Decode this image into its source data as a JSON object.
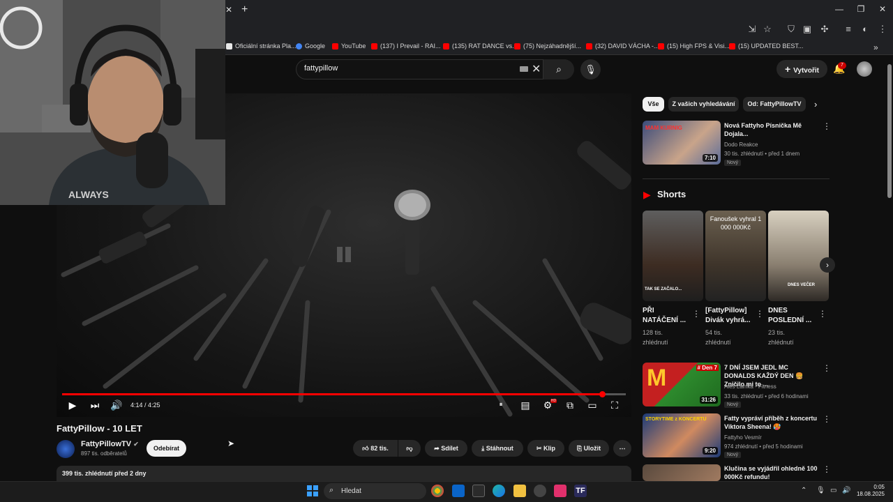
{
  "browser": {
    "close_tab": "✕",
    "new_tab": "+",
    "window_buttons": [
      "—",
      "❐",
      "✕"
    ],
    "bookmarks": [
      {
        "label": "Oficiální stránka Pla...",
        "color": "#e8e8e8"
      },
      {
        "label": "Google",
        "color": "#4285f4"
      },
      {
        "label": "YouTube",
        "color": "#ff0000"
      },
      {
        "label": "(137) I Prevail - RAI...",
        "color": "#ff0000"
      },
      {
        "label": "(135) RAT DANCE vs...",
        "color": "#ff0000"
      },
      {
        "label": "(75) Nejzáhadnější...",
        "color": "#ff0000"
      },
      {
        "label": "(32) DAVID VÁCHA -...",
        "color": "#ff0000"
      },
      {
        "label": "(15) High FPS & Visi...",
        "color": "#ff0000"
      },
      {
        "label": "(15) UPDATED BEST...",
        "color": "#ff0000"
      }
    ],
    "more": "»"
  },
  "webcam": {
    "shirt_text": "ALWAYS"
  },
  "header": {
    "search_value": "fattypillow",
    "create_label": "Vytvořit",
    "notification_count": "7"
  },
  "player": {
    "time": "4:14 / 4:25",
    "progress_fraction": 0.958,
    "hd_badge": "HD"
  },
  "video": {
    "title": "FattyPillow - 10 LET",
    "channel": "FattyPillowTV",
    "subscribers": "897 tis. odběratelů",
    "subscribe_label": "Odebírat",
    "likes": "82 tis.",
    "share_label": "Sdílet",
    "download_label": "Stáhnout",
    "clip_label": "Klip",
    "save_label": "Uložit",
    "description_meta": "399 tis. zhlédnutí  před 2 dny"
  },
  "sidebar": {
    "chips": [
      "Vše",
      "Z vašich vyhledávání",
      "Od: FattyPillowTV"
    ],
    "shorts_heading": "Shorts",
    "recommendations": [
      {
        "title": "Nová Fattyho Písnička Mě Dojala...",
        "channel": "Dodo Reakce",
        "meta": "30 tis. zhlédnutí • před 1 dnem",
        "duration": "7:10",
        "badge": "Nový",
        "overlay": "MAM KURNIG"
      },
      {
        "title": "7 DNÍ JSEM JEDL MC DONALDS KAŽDÝ DEN 🍔 Zničilo mi to ...",
        "channel": "Aleš Lamka - Fitness",
        "meta": "33 tis. zhlédnutí • před 6 hodinami",
        "duration": "31:26",
        "badge": "Nový",
        "overlay": "# Den 7"
      },
      {
        "title": "Fatty vypráví příběh z koncertu Viktora Sheena! 🥵",
        "channel": "Fattyho Vesmír",
        "meta": "974 zhlédnutí • před 5 hodinami",
        "duration": "9:20",
        "badge": "Nový",
        "overlay": "STORYTIME z KONCERTU"
      },
      {
        "title": "Klučina se vyjádřil ohledně 100 000Kč refundu!",
        "channel": "",
        "meta": "",
        "duration": "",
        "badge": "",
        "overlay": ""
      }
    ],
    "shorts": [
      {
        "title1": "PŘI",
        "title2": "NATÁČENÍ ...",
        "views1": "128 tis.",
        "views2": "zhlédnutí",
        "overlay": "TAK SE ZAČALO..."
      },
      {
        "title1": "[FattyPillow]",
        "title2": "Divák vyhrá...",
        "views1": "54 tis.",
        "views2": "zhlédnutí",
        "overlay": "Fanoušek vyhral 1 000 000Kč"
      },
      {
        "title1": "DNES",
        "title2": "POSLEDNÍ ...",
        "views1": "23 tis.",
        "views2": "zhlédnutí",
        "overlay": "DNES VEČER"
      }
    ]
  },
  "taskbar": {
    "search_label": "Hledat",
    "time": "0:05",
    "date": "18.08.2025"
  }
}
